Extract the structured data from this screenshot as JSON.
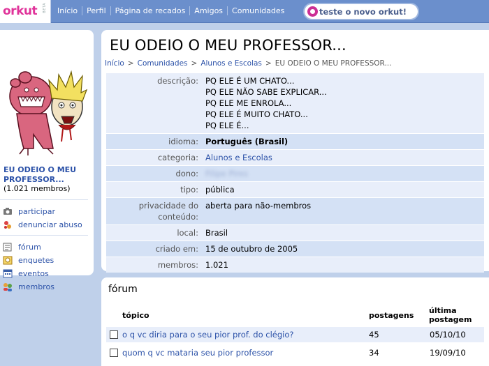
{
  "header": {
    "logo_text": "orkut",
    "logo_beta": "BETA",
    "nav": [
      "Início",
      "Perfil",
      "Página de recados",
      "Amigos",
      "Comunidades"
    ],
    "try_button": "teste o novo orkut!"
  },
  "sidebar": {
    "community_name": "EU ODEIO O MEU PROFESSOR...",
    "members_count": "(1.021 membros)",
    "actions": [
      {
        "label": "participar",
        "icon": "camera-icon"
      },
      {
        "label": "denunciar abuso",
        "icon": "report-abuse-icon"
      }
    ],
    "menu": [
      {
        "label": "fórum",
        "icon": "forum-icon"
      },
      {
        "label": "enquetes",
        "icon": "polls-icon"
      },
      {
        "label": "eventos",
        "icon": "calendar-icon"
      },
      {
        "label": "membros",
        "icon": "members-icon"
      }
    ]
  },
  "main": {
    "title": "EU ODEIO O MEU PROFESSOR...",
    "breadcrumb": [
      "Início",
      "Comunidades",
      "Alunos e Escolas",
      "EU ODEIO O MEU PROFESSOR..."
    ],
    "info": {
      "descricao_label": "descrição:",
      "descricao_lines": [
        "PQ ELE É UM CHATO...",
        "PQ ELE NÃO SABE EXPLICAR...",
        "PQ ELE ME ENROLA...",
        "PQ ELE É MUITO CHATO...",
        "PQ ELE É..."
      ],
      "idioma_label": "idioma:",
      "idioma_value": "Português (Brasil)",
      "categoria_label": "categoria:",
      "categoria_value": "Alunos e Escolas",
      "dono_label": "dono:",
      "dono_value": "Filipe Pires",
      "tipo_label": "tipo:",
      "tipo_value": "pública",
      "privacidade_label_1": "privacidade do",
      "privacidade_label_2": "conteúdo:",
      "privacidade_value": "aberta para não-membros",
      "local_label": "local:",
      "local_value": "Brasil",
      "criado_label": "criado em:",
      "criado_value": "15 de outubro de 2005",
      "membros_label": "membros:",
      "membros_value": "1.021"
    }
  },
  "forum": {
    "title": "fórum",
    "col_topic": "tópico",
    "col_posts": "postagens",
    "col_last_1": "última",
    "col_last_2": "postagem",
    "rows": [
      {
        "topic": "o q vc diria para o seu pior prof. do clégio?",
        "posts": "45",
        "last": "05/10/10"
      },
      {
        "topic": "quom q vc mataria seu pior professor",
        "posts": "34",
        "last": "19/09/10"
      }
    ]
  },
  "colors": {
    "topbar": "#6b8fcc",
    "background": "#bfd0ea",
    "link": "#2c52a8",
    "brand_pink": "#e0339a"
  }
}
